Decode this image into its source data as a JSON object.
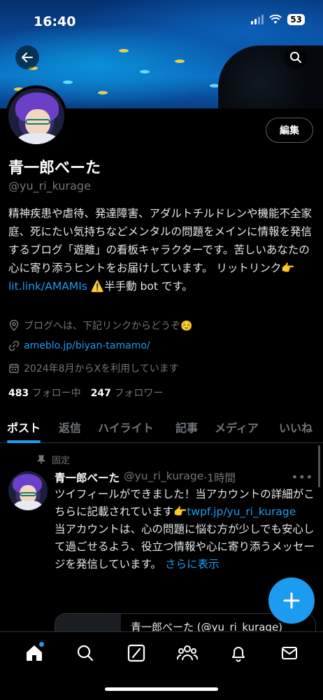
{
  "status_bar": {
    "time": "16:40",
    "battery": "53"
  },
  "profile": {
    "name": "青一郎べーた",
    "handle": "@yu_ri_kurage",
    "edit_label": "編集",
    "bio_part1": "精神疾患や虐待、発達障害、アダルトチルドレンや機能不全家庭、死にたい気持ちなどメンタルの問題をメインに情報を発信するブログ「遊離」の看板キャラクターです。苦しいあなたの心に寄り添うヒントをお届けしています。 リットリンク👉 ",
    "bio_link": "lit.link/AMAMIs",
    "bio_part2": " ⚠️半手動 bot です。",
    "location": "ブログへは、下記リンクからどうぞ☺️",
    "website": "ameblo.jp/biyan-tamamo/",
    "joined": "2024年8月からXを利用しています",
    "following_count": "483",
    "following_label": "フォロー中",
    "followers_count": "247",
    "followers_label": "フォロワー"
  },
  "tabs": [
    {
      "label": "ポスト",
      "active": true
    },
    {
      "label": "返信",
      "active": false
    },
    {
      "label": "ハイライト",
      "active": false
    },
    {
      "label": "記事",
      "active": false
    },
    {
      "label": "メディア",
      "active": false
    },
    {
      "label": "いいね",
      "active": false
    }
  ],
  "post": {
    "pinned_label": "固定",
    "author_name": "青一郎べーた",
    "author_handle": "@yu_ri_kurage",
    "time": "·1時間",
    "text1": "ツイフィールができました！当アカウントの詳細がこちらに記載されています👉",
    "link": "twpf.jp/yu_ri_kurage",
    "text2": "当アカウントは、心の問題に悩む方が少しでも安心して過ごせるよう、役立つ情報や心に寄り添うメッセージを発信しています。",
    "more_label": "さらに表示",
    "card_title": "青一郎べーた (@yu_ri_kurage)"
  },
  "colors": {
    "accent": "#1d9bf0",
    "background": "#000000",
    "muted": "#71767b"
  },
  "icons": {
    "back": "arrow-left-icon",
    "search": "search-icon",
    "location": "location-pin-icon",
    "link": "link-icon",
    "calendar": "calendar-icon",
    "pin": "pin-icon",
    "compose": "plus-icon",
    "nav": [
      "home-icon",
      "search-icon",
      "grok-icon",
      "communities-icon",
      "bell-icon",
      "mail-icon"
    ]
  }
}
